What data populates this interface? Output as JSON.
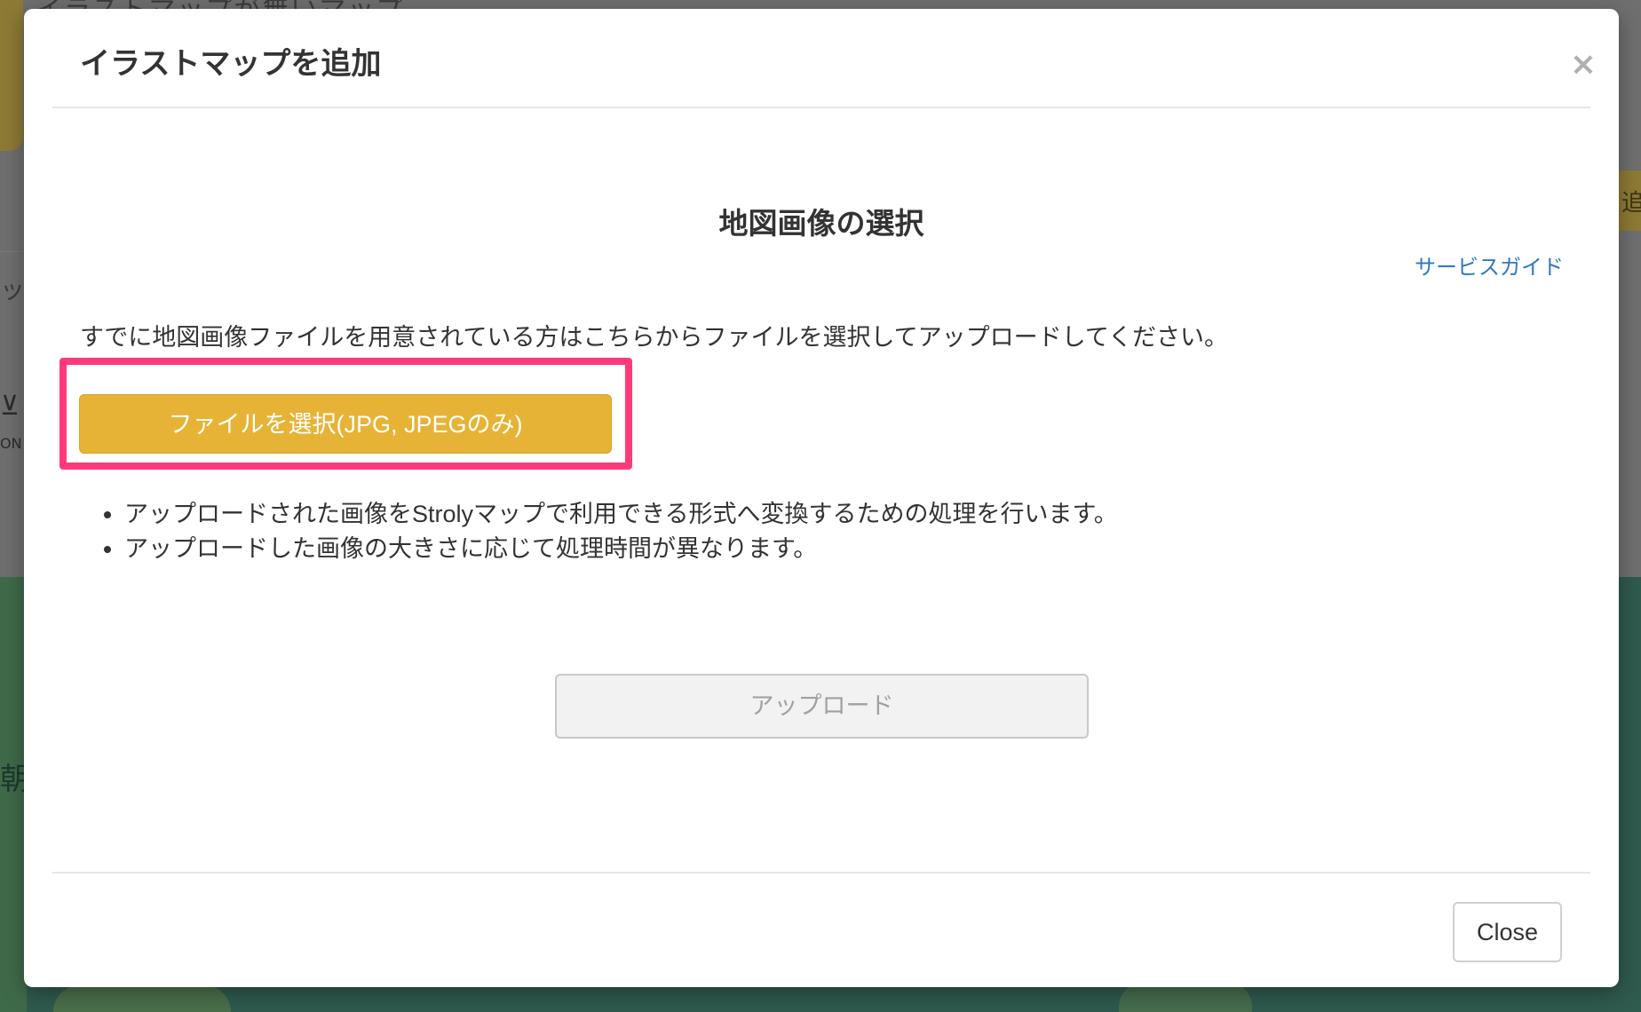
{
  "background": {
    "top_text": "イラストマップが無いマップ",
    "right_tab_text": "追",
    "left_text_1": "ット",
    "left_text_2": "⊻",
    "left_text_3": "ON",
    "left_map_text": "朝"
  },
  "modal": {
    "title": "イラストマップを追加",
    "close_icon": "×",
    "section_title": "地図画像の選択",
    "service_guide_link": "サービスガイド",
    "intro_text": "すでに地図画像ファイルを用意されている方はこちらからファイルを選択してアップロードしてください。",
    "choose_file_button": "ファイルを選択(JPG, JPEGのみ)",
    "notes": [
      "アップロードされた画像をStrolyマップで利用できる形式へ変換するための処理を行います。",
      "アップロードした画像の大きさに応じて処理時間が異なります。"
    ],
    "upload_button": "アップロード",
    "close_button": "Close"
  },
  "colors": {
    "accent_button": "#e6b336",
    "highlight_border": "#ff3a7a",
    "link": "#2f79c2",
    "text": "#333333",
    "disabled_text": "#a0a0a0"
  }
}
